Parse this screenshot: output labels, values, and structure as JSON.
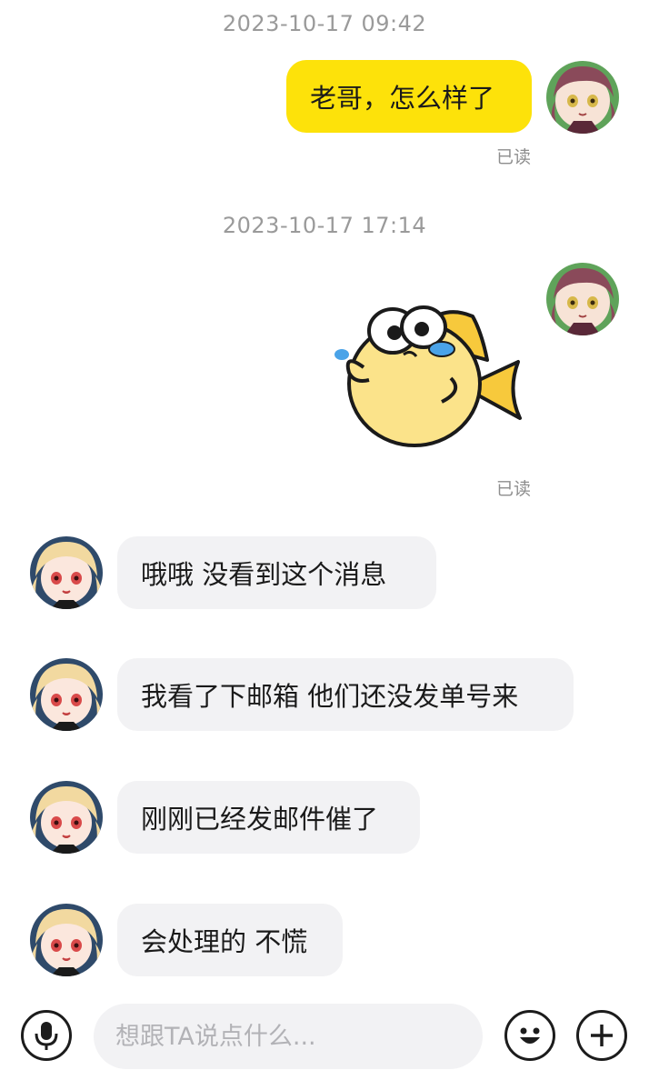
{
  "messages": [
    {
      "timestamp": "2023-10-17 09:42"
    },
    {
      "text": "老哥，怎么样了",
      "status": "已读"
    },
    {
      "timestamp": "2023-10-17 17:14"
    },
    {
      "status": "已读"
    },
    {
      "text": "哦哦  没看到这个消息"
    },
    {
      "text": "我看了下邮箱 他们还没发单号来"
    },
    {
      "text": "刚刚已经发邮件催了"
    },
    {
      "text": "会处理的 不慌"
    }
  ],
  "composer": {
    "placeholder": "想跟TA说点什么...",
    "voice_icon": "microphone-icon",
    "emoji_icon": "smiley-icon",
    "plus_icon": "plus-icon"
  },
  "colors": {
    "mine_bubble": "#fde20a",
    "their_bubble": "#f2f2f4",
    "timestamp": "#9a9a9a"
  }
}
